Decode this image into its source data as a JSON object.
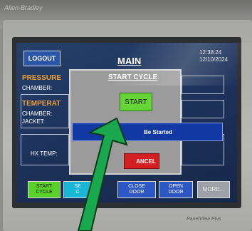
{
  "device": {
    "brand_text": "Allen-Bradley",
    "model_text": "PanelView Plus"
  },
  "header": {
    "logout_label": "LOGOUT",
    "title": "MAIN",
    "time": "12:38:24",
    "date": "12/10/2024"
  },
  "readings": {
    "pressure_label": "PRESSURE",
    "chamber_label": "CHAMBER:",
    "temperature_label": "TEMPERAT",
    "temp_chamber_label": "CHAMBER:",
    "jacket_label": "JACKET:",
    "hx_temp_label": "HX TEMP:"
  },
  "dialog": {
    "title": "START CYCLE",
    "start_label": "START",
    "message": "Be Started",
    "cancel_label": "ANCEL"
  },
  "bottom_buttons": [
    {
      "label": "START\nCYCLE",
      "color": "#5ad128"
    },
    {
      "label": "SE\nC",
      "color": "#19b6d8"
    },
    {
      "label": "CLOSE\nDOOR",
      "color": "#2d58c4"
    },
    {
      "label": "OPEN\nDOOR",
      "color": "#2d58c4"
    },
    {
      "label": "MORE...",
      "color": "#9ea2a8"
    }
  ],
  "colors": {
    "screen_bg": "#1c3158",
    "accent_orange": "#f0a032",
    "start_green": "#64d437",
    "cancel_red": "#d21f22",
    "message_blue": "#1238a4",
    "arrow_green": "#1aa84e"
  },
  "icons": {
    "pointer": "arrow-annotation-icon"
  }
}
